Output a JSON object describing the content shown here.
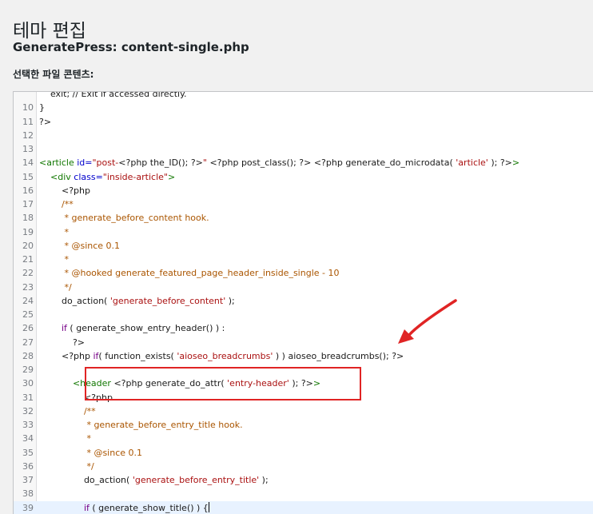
{
  "page": {
    "heading": "테마 편집",
    "file_title": "GeneratePress: content-single.php",
    "section_label": "선택한 파일 콘텐츠:"
  },
  "editor": {
    "active_line": "39",
    "lines": [
      {
        "n": "",
        "t": [
          [
            "def",
            "    exit; // Exit if accessed directly."
          ]
        ]
      },
      {
        "n": "10",
        "t": [
          [
            "def",
            "}"
          ]
        ]
      },
      {
        "n": "11",
        "t": [
          [
            "def",
            "?>"
          ]
        ]
      },
      {
        "n": "12",
        "t": []
      },
      {
        "n": "13",
        "t": []
      },
      {
        "n": "14",
        "t": [
          [
            "tag",
            "<article "
          ],
          [
            "attr",
            "id="
          ],
          [
            "str",
            "\"post-"
          ],
          [
            "def",
            "<?php the_ID(); ?>"
          ],
          [
            "str",
            "\""
          ],
          [
            "def",
            " <?php post_class(); ?> <?php generate_do_microdata( "
          ],
          [
            "str",
            "'article'"
          ],
          [
            "def",
            " ); ?>"
          ],
          [
            "tag",
            ">"
          ]
        ]
      },
      {
        "n": "15",
        "t": [
          [
            "def",
            "    "
          ],
          [
            "tag",
            "<div "
          ],
          [
            "attr",
            "class="
          ],
          [
            "str",
            "\"inside-article\""
          ],
          [
            "tag",
            ">"
          ]
        ]
      },
      {
        "n": "16",
        "t": [
          [
            "def",
            "        <?php"
          ]
        ]
      },
      {
        "n": "17",
        "t": [
          [
            "def",
            "        "
          ],
          [
            "cmt",
            "/**"
          ]
        ]
      },
      {
        "n": "18",
        "t": [
          [
            "def",
            "        "
          ],
          [
            "cmt",
            " * generate_before_content hook."
          ]
        ]
      },
      {
        "n": "19",
        "t": [
          [
            "def",
            "        "
          ],
          [
            "cmt",
            " *"
          ]
        ]
      },
      {
        "n": "20",
        "t": [
          [
            "def",
            "        "
          ],
          [
            "cmt",
            " * @since 0.1"
          ]
        ]
      },
      {
        "n": "21",
        "t": [
          [
            "def",
            "        "
          ],
          [
            "cmt",
            " *"
          ]
        ]
      },
      {
        "n": "22",
        "t": [
          [
            "def",
            "        "
          ],
          [
            "cmt",
            " * @hooked generate_featured_page_header_inside_single - 10"
          ]
        ]
      },
      {
        "n": "23",
        "t": [
          [
            "def",
            "        "
          ],
          [
            "cmt",
            " */"
          ]
        ]
      },
      {
        "n": "24",
        "t": [
          [
            "def",
            "        do_action( "
          ],
          [
            "str",
            "'generate_before_content'"
          ],
          [
            "def",
            " );"
          ]
        ]
      },
      {
        "n": "25",
        "t": []
      },
      {
        "n": "26",
        "t": [
          [
            "def",
            "        "
          ],
          [
            "kw",
            "if"
          ],
          [
            "def",
            " ( generate_show_entry_header() ) :"
          ]
        ]
      },
      {
        "n": "27",
        "t": [
          [
            "def",
            "            ?>"
          ]
        ]
      },
      {
        "n": "28",
        "t": [
          [
            "def",
            "        <?php "
          ],
          [
            "kw",
            "if"
          ],
          [
            "def",
            "( function_exists( "
          ],
          [
            "str",
            "'aioseo_breadcrumbs'"
          ],
          [
            "def",
            " ) ) aioseo_breadcrumbs(); ?>"
          ]
        ]
      },
      {
        "n": "29",
        "t": []
      },
      {
        "n": "30",
        "t": [
          [
            "def",
            "            "
          ],
          [
            "tag",
            "<header "
          ],
          [
            "def",
            "<?php generate_do_attr( "
          ],
          [
            "str",
            "'entry-header'"
          ],
          [
            "def",
            " ); ?>"
          ],
          [
            "tag",
            ">"
          ]
        ]
      },
      {
        "n": "31",
        "t": [
          [
            "def",
            "                <?php"
          ]
        ]
      },
      {
        "n": "32",
        "t": [
          [
            "def",
            "                "
          ],
          [
            "cmt",
            "/**"
          ]
        ]
      },
      {
        "n": "33",
        "t": [
          [
            "def",
            "                "
          ],
          [
            "cmt",
            " * generate_before_entry_title hook."
          ]
        ]
      },
      {
        "n": "34",
        "t": [
          [
            "def",
            "                "
          ],
          [
            "cmt",
            " *"
          ]
        ]
      },
      {
        "n": "35",
        "t": [
          [
            "def",
            "                "
          ],
          [
            "cmt",
            " * @since 0.1"
          ]
        ]
      },
      {
        "n": "36",
        "t": [
          [
            "def",
            "                "
          ],
          [
            "cmt",
            " */"
          ]
        ]
      },
      {
        "n": "37",
        "t": [
          [
            "def",
            "                do_action( "
          ],
          [
            "str",
            "'generate_before_entry_title'"
          ],
          [
            "def",
            " );"
          ]
        ]
      },
      {
        "n": "38",
        "t": []
      },
      {
        "n": "39",
        "t": [
          [
            "def",
            "                "
          ],
          [
            "kw",
            "if"
          ],
          [
            "def",
            " ( generate_show_title() ) {"
          ]
        ]
      }
    ]
  },
  "annotation": {
    "box_color": "#e02424",
    "arrow_color": "#e02424"
  }
}
